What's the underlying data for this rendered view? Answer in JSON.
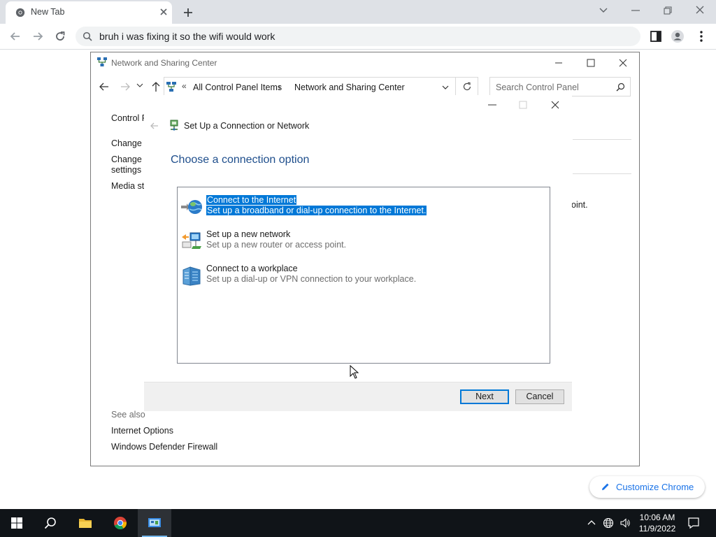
{
  "chrome": {
    "tab_title": "New Tab",
    "omnibox_text": "bruh i was fixing it so the wifi would work",
    "customize_label": "Customize Chrome"
  },
  "nsc": {
    "title": "Network and Sharing Center",
    "breadcrumb_root": "All Control Panel Items",
    "breadcrumb_current": "Network and Sharing Center",
    "search_placeholder": "Search Control Panel",
    "sidebar": {
      "item1": "Control Panel Home",
      "item2": "Change adapter settings",
      "item3_line1": "Change advanced sharing",
      "item3_line2": "settings",
      "item4": "Media streaming options"
    },
    "right_partial_text": "oint.",
    "see_also": "See also",
    "see_also_links": [
      "Internet Options",
      "Windows Defender Firewall"
    ]
  },
  "dialog": {
    "title": "Set Up a Connection or Network",
    "heading": "Choose a connection option",
    "options": [
      {
        "title": "Connect to the Internet",
        "desc": "Set up a broadband or dial-up connection to the Internet.",
        "icon": "globe-connect-icon"
      },
      {
        "title": "Set up a new network",
        "desc": "Set up a new router or access point.",
        "icon": "router-network-icon"
      },
      {
        "title": "Connect to a workplace",
        "desc": "Set up a dial-up or VPN connection to your workplace.",
        "icon": "workplace-building-icon"
      }
    ],
    "next_label": "Next",
    "cancel_label": "Cancel"
  },
  "taskbar": {
    "time": "10:06 AM",
    "date": "11/9/2022"
  },
  "colors": {
    "selection": "#0078d7",
    "heading_blue": "#1e4e8c",
    "chrome_link": "#1a73e8",
    "taskbar": "#101418"
  }
}
